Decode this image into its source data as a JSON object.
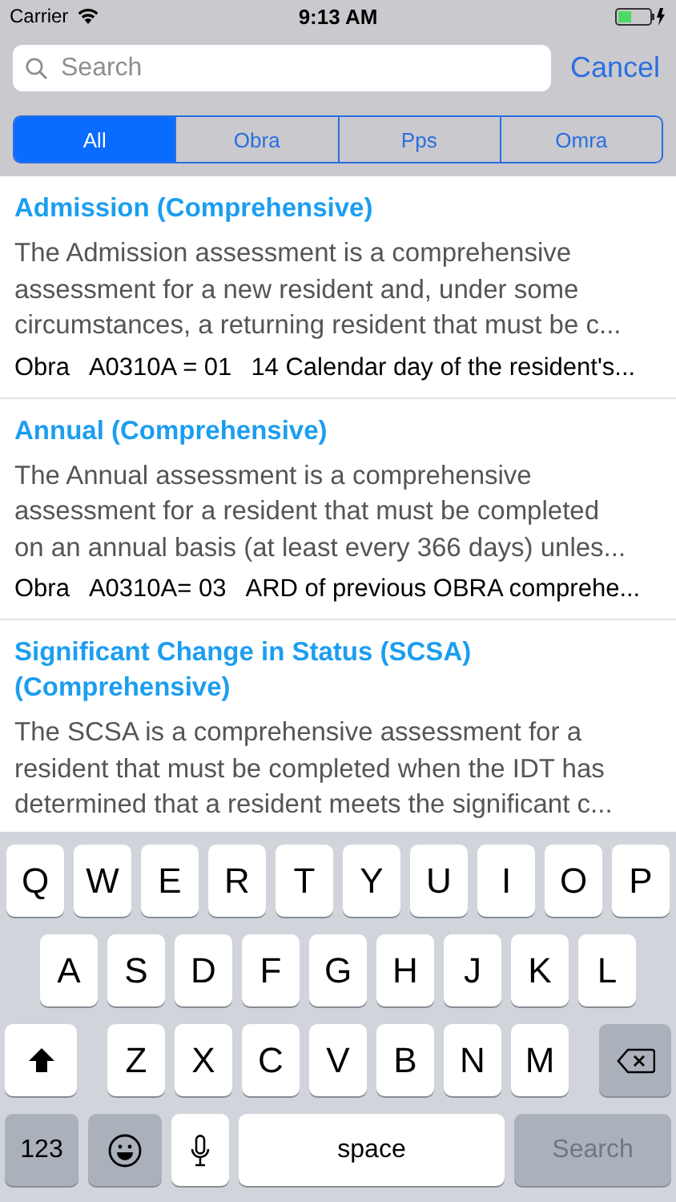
{
  "status_bar": {
    "carrier": "Carrier",
    "time": "9:13 AM"
  },
  "search": {
    "placeholder": "Search",
    "cancel": "Cancel"
  },
  "tabs": [
    {
      "label": "All",
      "selected": true
    },
    {
      "label": "Obra",
      "selected": false
    },
    {
      "label": "Pps",
      "selected": false
    },
    {
      "label": "Omra",
      "selected": false
    }
  ],
  "results": [
    {
      "title": "Admission (Comprehensive)",
      "description_lines": [
        "The Admission assessment is a comprehensive",
        "assessment for a new resident and, under some",
        "circumstances, a returning resident that must be c..."
      ],
      "type": "Obra",
      "code": "A0310A = 01",
      "detail": "14 Calendar day of the resident's..."
    },
    {
      "title": "Annual (Comprehensive)",
      "description_lines": [
        "The Annual assessment is a comprehensive",
        "assessment for a resident that must be completed",
        "on an annual basis (at least every 366 days) unles..."
      ],
      "type": "Obra",
      "code": "A0310A= 03",
      "detail": "ARD of previous OBRA comprehe..."
    },
    {
      "title": "Significant Change in Status (SCSA) (Comprehensive)",
      "description_lines": [
        "The SCSA is a comprehensive assessment for a",
        "resident that must be completed when the IDT has",
        "determined that a resident meets the significant c..."
      ]
    }
  ],
  "keyboard": {
    "rows": [
      [
        "Q",
        "W",
        "E",
        "R",
        "T",
        "Y",
        "U",
        "I",
        "O",
        "P"
      ],
      [
        "A",
        "S",
        "D",
        "F",
        "G",
        "H",
        "J",
        "K",
        "L"
      ],
      [
        "Z",
        "X",
        "C",
        "V",
        "B",
        "N",
        "M"
      ]
    ],
    "numbers_key": "123",
    "space_key": "space",
    "search_key": "Search"
  }
}
